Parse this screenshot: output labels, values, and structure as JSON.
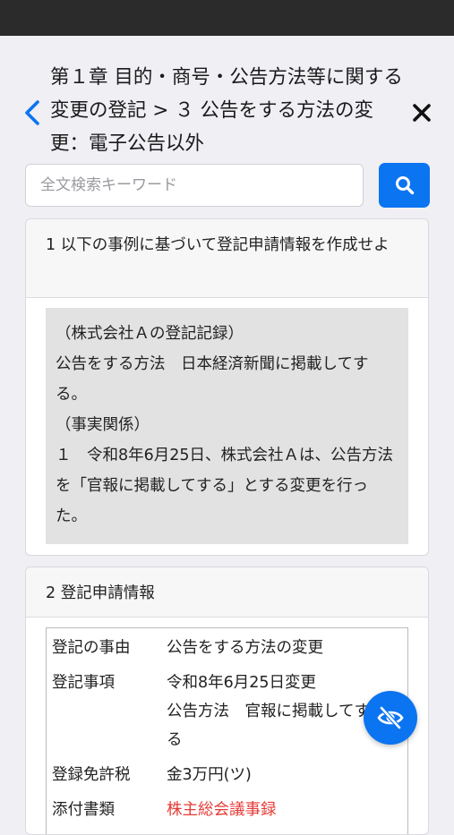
{
  "header": {
    "title": "第１章 目的・商号・公告方法等に関する変更の登記 > ３ 公告をする方法の変更：電子公告以外"
  },
  "search": {
    "placeholder": "全文検索キーワード",
    "value": ""
  },
  "card1": {
    "heading": "1 以下の事例に基づいて登記申請情報を作成せよ",
    "lines": [
      "（株式会社Ａの登記記録）",
      "公告をする方法　日本経済新聞に掲載してする。",
      "（事実関係）",
      "１　令和8年6月25日、株式会社Ａは、公告方法を「官報に掲載してする」とする変更を行った。"
    ]
  },
  "card2": {
    "heading": "2 登記申請情報",
    "rows": [
      {
        "key": "登記の事由",
        "value": "公告をする方法の変更"
      },
      {
        "key": "登記事項",
        "value": "令和8年6月25日変更",
        "value2": "公告方法　官報に掲載してする"
      },
      {
        "key": "登録免許税",
        "value": "金3万円(ツ)"
      },
      {
        "key": "添付書類",
        "value": "株主総会議事録"
      }
    ]
  },
  "colors": {
    "accent": "#0b74f1",
    "background": "#efeff4",
    "statusbar": "#2b2b2b",
    "highlight_red": "#e53935"
  },
  "icons": {
    "back": "chevron-left-icon",
    "close": "close-icon",
    "search": "search-icon",
    "fab": "eye-off-icon"
  }
}
